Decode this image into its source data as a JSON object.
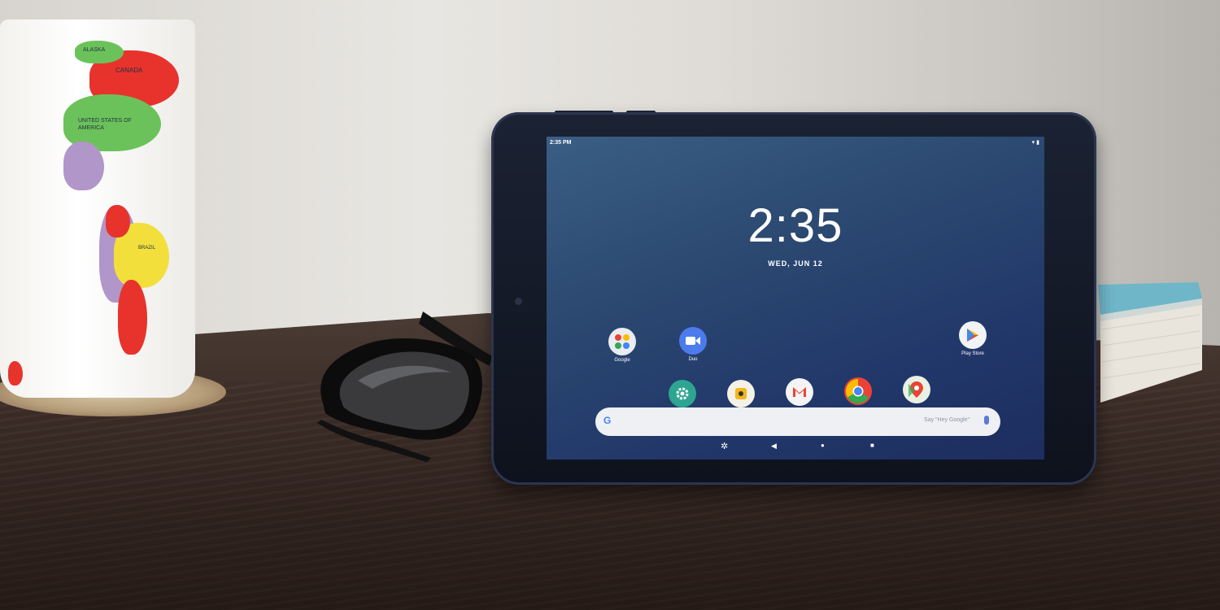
{
  "tablet": {
    "status_time": "2:35 PM",
    "clock": "2:35",
    "date": "WED, JUN 12",
    "apps": [
      {
        "label": "Google",
        "icon": "google-folder-icon"
      },
      {
        "label": "Duo",
        "icon": "duo-icon"
      },
      {
        "label": "Play Store",
        "icon": "play-store-icon"
      }
    ],
    "dock": [
      "settings-icon",
      "camera-icon",
      "gmail-icon",
      "chrome-icon",
      "maps-icon"
    ],
    "search": {
      "logo": "G",
      "hint": "Say \"Hey Google\""
    },
    "nav": {
      "assist": "✲",
      "back": "◀",
      "home": "●",
      "recents": "■"
    }
  },
  "mug": {
    "labels": [
      "ALASKA",
      "CANADA",
      "UNITED STATES OF AMERICA",
      "BRAZIL"
    ]
  },
  "colors": {
    "screen": "#2c4a72",
    "tablet_body": "#0e121d",
    "desk": "#3b2c26"
  }
}
